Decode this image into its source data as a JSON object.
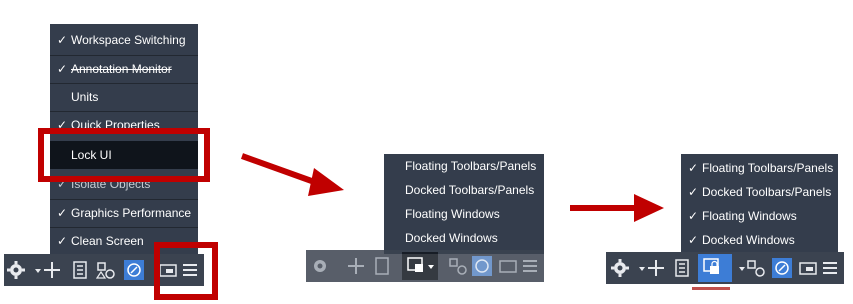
{
  "left_menu": {
    "items": [
      {
        "label": "Workspace Switching",
        "checked": true
      },
      {
        "label": "Annotation Monitor",
        "checked": true
      },
      {
        "label": "Units",
        "checked": false
      },
      {
        "label": "Quick Properties",
        "checked": true
      },
      {
        "label": "Lock UI",
        "checked": false
      },
      {
        "label": "Isolate Objects",
        "checked": true
      },
      {
        "label": "Graphics Performance",
        "checked": true
      },
      {
        "label": "Clean Screen",
        "checked": true
      }
    ]
  },
  "middle_menu": {
    "items": [
      {
        "label": "Floating Toolbars/Panels",
        "checked": false
      },
      {
        "label": "Docked Toolbars/Panels",
        "checked": false
      },
      {
        "label": "Floating Windows",
        "checked": false
      },
      {
        "label": "Docked Windows",
        "checked": false
      }
    ]
  },
  "right_menu": {
    "items": [
      {
        "label": "Floating Toolbars/Panels",
        "checked": true
      },
      {
        "label": "Docked Toolbars/Panels",
        "checked": true
      },
      {
        "label": "Floating Windows",
        "checked": true
      },
      {
        "label": "Docked Windows",
        "checked": true
      }
    ]
  },
  "check_glyph": "✓",
  "colors": {
    "menu_bg": "#343d4c",
    "statusbar_bg": "#3b4350",
    "highlight_red": "#c00000",
    "active_blue": "#3d7dd6"
  },
  "status_icons": [
    "gear-icon",
    "dropdown-icon",
    "plus-icon",
    "calculator-icon",
    "shapes-icon",
    "graphics-performance-icon",
    "clean-screen-icon",
    "customization-icon",
    "lock-ui-icon"
  ]
}
